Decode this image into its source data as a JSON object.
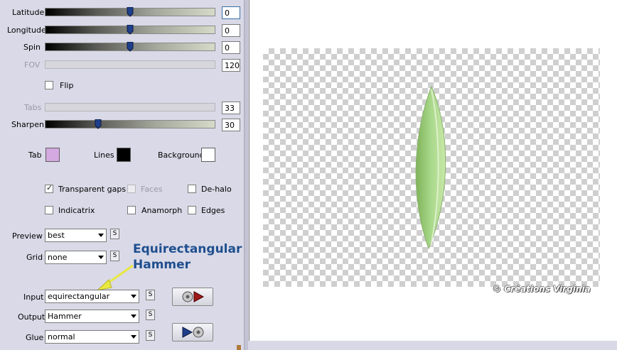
{
  "sliders": [
    {
      "label": "Latitude",
      "value": "0",
      "fraction": 0.5,
      "enabled": true
    },
    {
      "label": "Longitude",
      "value": "0",
      "fraction": 0.5,
      "enabled": true
    },
    {
      "label": "Spin",
      "value": "0",
      "fraction": 0.5,
      "enabled": true
    },
    {
      "label": "FOV",
      "value": "120",
      "enabled": false
    },
    {
      "label": "Tabs",
      "value": "33",
      "enabled": false
    },
    {
      "label": "Sharpen",
      "value": "30",
      "fraction": 0.3,
      "enabled": true
    }
  ],
  "flip": {
    "label": "Flip",
    "checked": false
  },
  "colors": {
    "tab": {
      "label": "Tab",
      "color": "#d4a8e0"
    },
    "lines": {
      "label": "Lines",
      "color": "#000000"
    },
    "background": {
      "label": "Background",
      "color": "#ffffff"
    }
  },
  "options": {
    "transparent_gaps": {
      "label": "Transparent gaps",
      "checked": true
    },
    "faces": {
      "label": "Faces",
      "checked": false,
      "enabled": false
    },
    "dehalo": {
      "label": "De-halo",
      "checked": false
    },
    "indicatrix": {
      "label": "Indicatrix",
      "checked": false
    },
    "anamorph": {
      "label": "Anamorph",
      "checked": false
    },
    "edges": {
      "label": "Edges",
      "checked": false
    }
  },
  "preview": {
    "label": "Preview",
    "value": "best"
  },
  "grid": {
    "label": "Grid",
    "value": "none"
  },
  "s_button_label": "S",
  "input": {
    "label": "Input",
    "value": "equirectangular"
  },
  "output": {
    "label": "Output",
    "value": "Hammer"
  },
  "glue": {
    "label": "Glue",
    "value": "normal"
  },
  "annotation": {
    "line1": "Equirectangular",
    "line2": "Hammer"
  },
  "watermark": "© Créations Virginia",
  "icons": {
    "thumb": "slider-thumb-icon",
    "arrow": "arrow-icon",
    "play": "play-icon",
    "disc": "disc-icon"
  }
}
